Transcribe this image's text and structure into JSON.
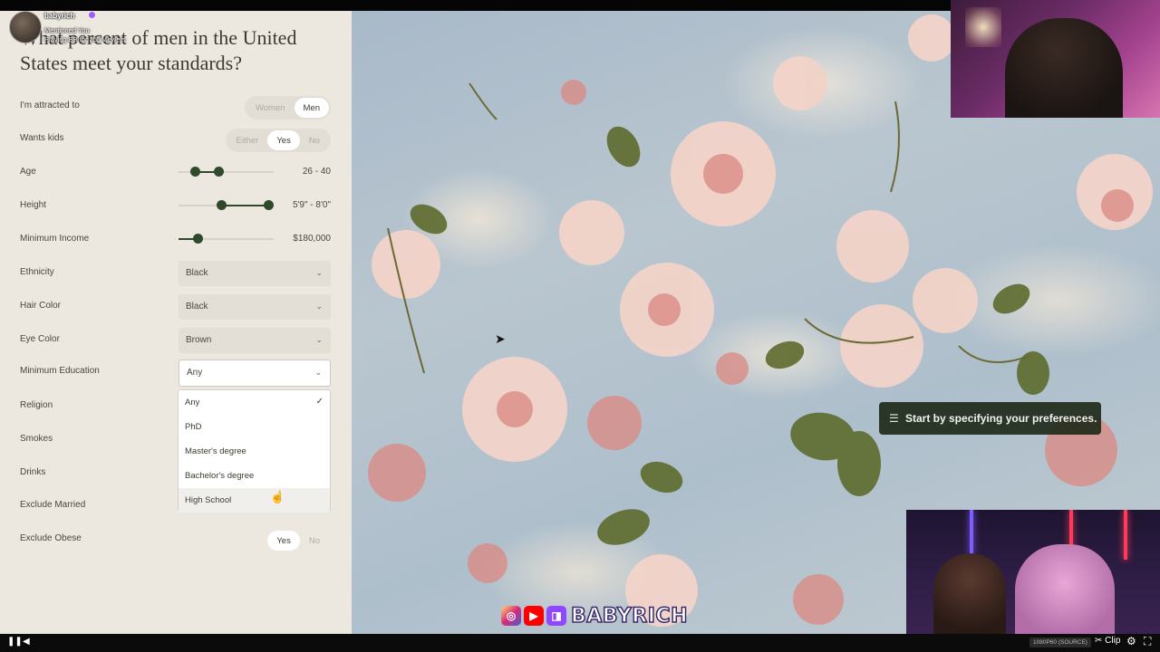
{
  "notification": {
    "username": "babyrich",
    "line2": "Mentioned You",
    "line3": "Playing BB for 255 viewers"
  },
  "page": {
    "question": "What percent of men in the United States meet your standards?"
  },
  "filters": {
    "attracted": {
      "label": "I'm attracted to",
      "options": [
        "Women",
        "Men"
      ],
      "selected": "Men"
    },
    "wants_kids": {
      "label": "Wants kids",
      "options": [
        "Either",
        "Yes",
        "No"
      ],
      "selected": "Yes"
    },
    "age": {
      "label": "Age",
      "value_text": "26 - 40",
      "range_low_fraction": 0.18,
      "range_high_fraction": 0.42
    },
    "height": {
      "label": "Height",
      "value_text": "5'9\" - 8'0\"",
      "range_low_fraction": 0.45,
      "range_high_fraction": 0.95
    },
    "income": {
      "label": "Minimum Income",
      "value_text": "$180,000",
      "level_fraction": 0.2
    },
    "ethnicity": {
      "label": "Ethnicity",
      "value": "Black"
    },
    "hair_color": {
      "label": "Hair Color",
      "value": "Black"
    },
    "eye_color": {
      "label": "Eye Color",
      "value": "Brown"
    },
    "education": {
      "label": "Minimum Education",
      "value": "Any",
      "options": [
        "Any",
        "PhD",
        "Master's degree",
        "Bachelor's degree",
        "High School"
      ],
      "checked": "Any"
    },
    "religion": {
      "label": "Religion"
    },
    "smokes": {
      "label": "Smokes"
    },
    "drinks": {
      "label": "Drinks"
    },
    "exclude_married": {
      "label": "Exclude Married"
    },
    "exclude_obese": {
      "label": "Exclude Obese",
      "options": [
        "Yes",
        "No"
      ],
      "selected": "Yes"
    }
  },
  "toast": {
    "message": "Start by specifying your preferences."
  },
  "overlay": {
    "brand_name": "BABYRICH",
    "stream_badge": "1080P60 (SOURCE)",
    "clip_label": "Clip"
  },
  "colors": {
    "panel_bg": "#ece7df",
    "accent": "#2f4a2b",
    "toast_bg": "#1c2816"
  }
}
